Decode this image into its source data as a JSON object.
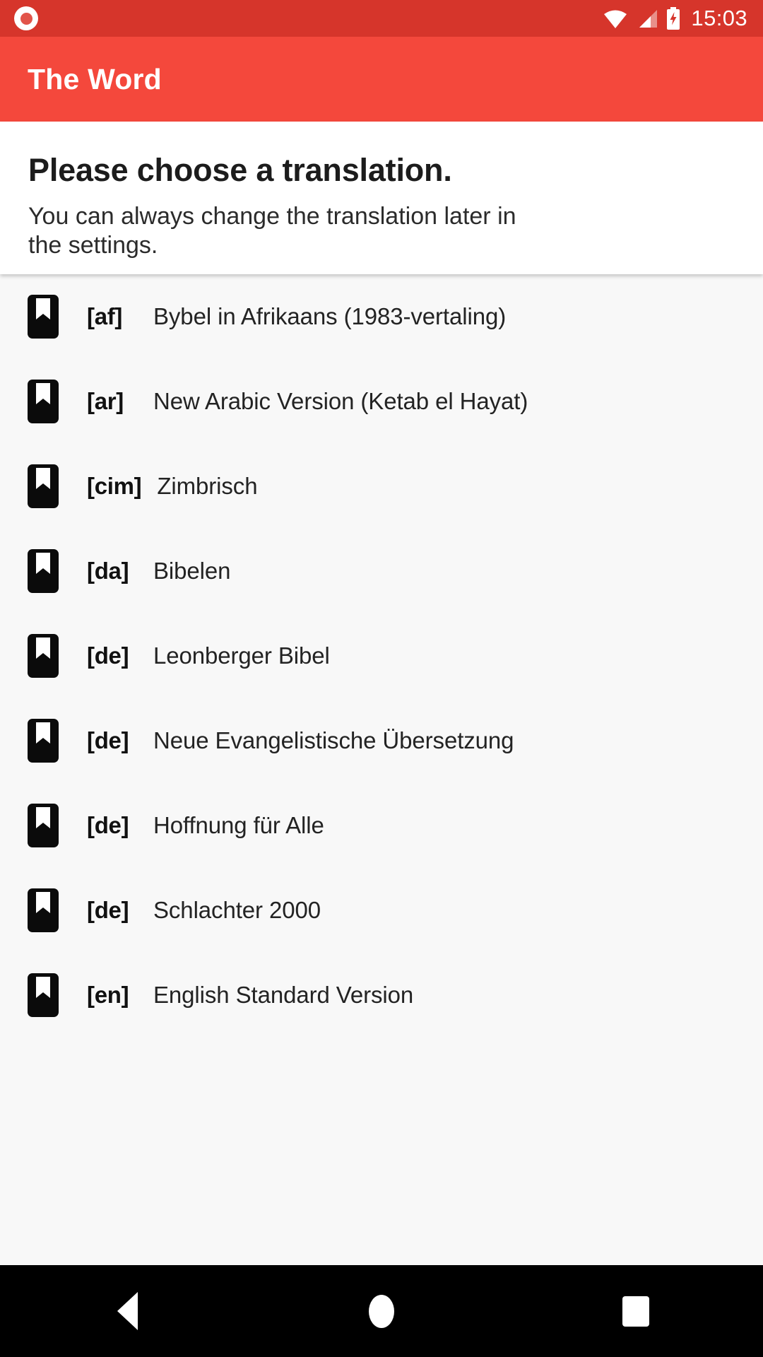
{
  "status_bar": {
    "app_indicator_icon": "record-dot-icon",
    "wifi_icon": "wifi-icon",
    "signal_icon": "cellular-signal-icon",
    "battery_icon": "battery-charging-icon",
    "time": "15:03",
    "background_color": "#d6352b"
  },
  "app_bar": {
    "title": "The Word",
    "background_color": "#f4483c",
    "text_color": "#ffffff"
  },
  "header": {
    "title": "Please choose a translation.",
    "subtitle": "You can always change the translation later in the settings."
  },
  "list": {
    "item_icon": "bible-bookmark-icon",
    "items": [
      {
        "code": "[af]",
        "name": "Bybel in Afrikaans (1983-vertaling)"
      },
      {
        "code": "[ar]",
        "name": "New Arabic Version (Ketab el Hayat)"
      },
      {
        "code": "[cim]",
        "name": "Zimbrisch"
      },
      {
        "code": "[da]",
        "name": "Bibelen"
      },
      {
        "code": "[de]",
        "name": "Leonberger Bibel"
      },
      {
        "code": "[de]",
        "name": "Neue Evangelistische Übersetzung"
      },
      {
        "code": "[de]",
        "name": "Hoffnung für Alle"
      },
      {
        "code": "[de]",
        "name": "Schlachter 2000"
      },
      {
        "code": "[en]",
        "name": "English Standard Version"
      }
    ]
  },
  "nav_bar": {
    "back_icon": "back-triangle-icon",
    "home_icon": "home-circle-icon",
    "recents_icon": "recents-square-icon",
    "background_color": "#000000"
  }
}
